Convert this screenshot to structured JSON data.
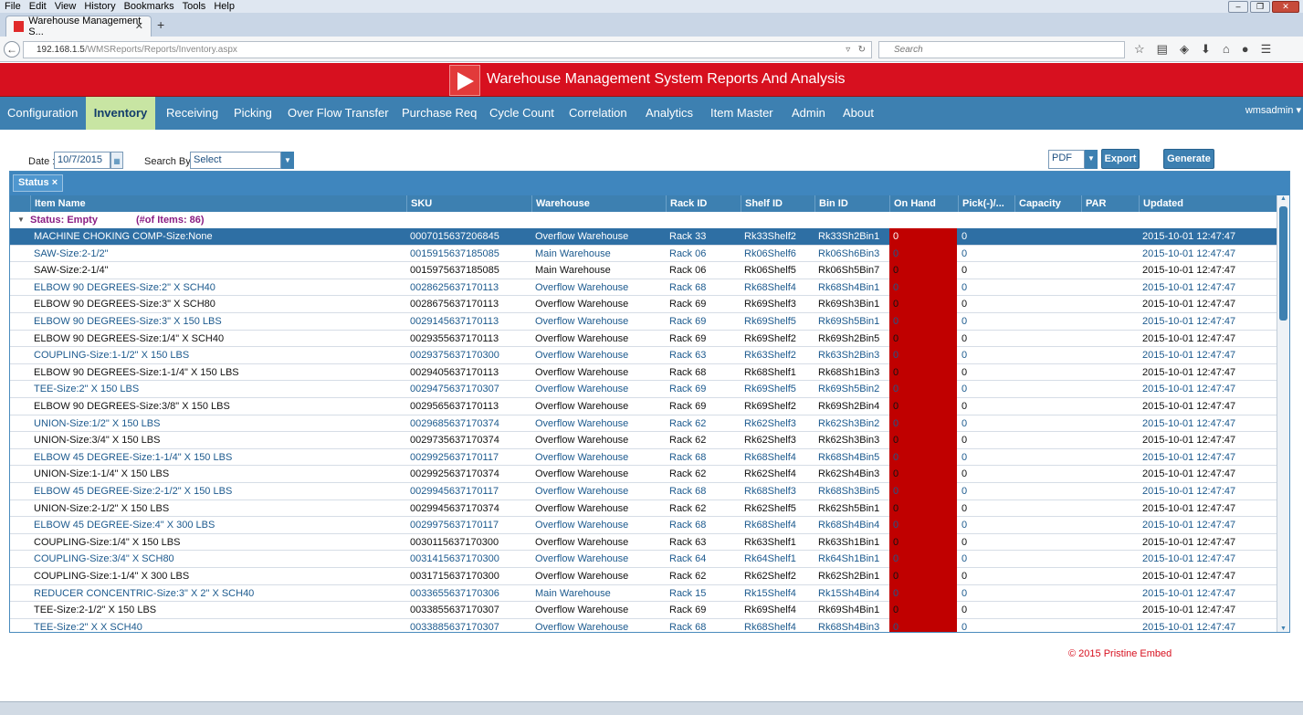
{
  "browser": {
    "menu": [
      "File",
      "Edit",
      "View",
      "History",
      "Bookmarks",
      "Tools",
      "Help"
    ],
    "tab_title": "Warehouse Management S...",
    "url_host": "192.168.1.5",
    "url_path": "/WMSReports/Reports/Inventory.aspx",
    "search_placeholder": "Search"
  },
  "app": {
    "title": "Warehouse Management System Reports And Analysis",
    "accent": "#d7101f",
    "nav_color": "#3d80b1"
  },
  "nav": {
    "items": [
      "Configuration",
      "Inventory",
      "Receiving",
      "Picking",
      "Over Flow Transfer",
      "Purchase Req",
      "Cycle Count",
      "Correlation",
      "Analytics",
      "Item Master",
      "Admin",
      "About"
    ],
    "active": "Inventory",
    "user": "wmsadmin"
  },
  "filters": {
    "date_label": "Date :",
    "date_value": "10/7/2015",
    "search_by_label": "Search By:",
    "search_by_value": "Select",
    "format_value": "PDF",
    "export_label": "Export",
    "generate_label": "Generate"
  },
  "grid": {
    "group_chip": "Status",
    "chip_close": "×",
    "columns": [
      "Item Name",
      "SKU",
      "Warehouse",
      "Rack ID",
      "Shelf ID",
      "Bin ID",
      "On Hand",
      "Pick(-)/...",
      "Capacity",
      "PAR",
      "Updated"
    ],
    "group_label": "Status: Empty",
    "group_count": "(#of Items: 86)",
    "rows": [
      [
        "MACHINE CHOKING COMP-Size:None",
        "0007015637206845",
        "Overflow Warehouse",
        "Rack 33",
        "Rk33Shelf2",
        "Rk33Sh2Bin1",
        "0",
        "0",
        "",
        "",
        "2015-10-01 12:47:47"
      ],
      [
        "SAW-Size:2-1/2\"",
        "0015915637185085",
        "Main Warehouse",
        "Rack 06",
        "Rk06Shelf6",
        "Rk06Sh6Bin3",
        "0",
        "0",
        "",
        "",
        "2015-10-01 12:47:47"
      ],
      [
        "SAW-Size:2-1/4\"",
        "0015975637185085",
        "Main Warehouse",
        "Rack 06",
        "Rk06Shelf5",
        "Rk06Sh5Bin7",
        "0",
        "0",
        "",
        "",
        "2015-10-01 12:47:47"
      ],
      [
        "ELBOW 90 DEGREES-Size:2\" X SCH40",
        "0028625637170113",
        "Overflow Warehouse",
        "Rack 68",
        "Rk68Shelf4",
        "Rk68Sh4Bin1",
        "0",
        "0",
        "",
        "",
        "2015-10-01 12:47:47"
      ],
      [
        "ELBOW 90 DEGREES-Size:3\" X SCH80",
        "0028675637170113",
        "Overflow Warehouse",
        "Rack 69",
        "Rk69Shelf3",
        "Rk69Sh3Bin1",
        "0",
        "0",
        "",
        "",
        "2015-10-01 12:47:47"
      ],
      [
        "ELBOW 90 DEGREES-Size:3\" X 150 LBS",
        "0029145637170113",
        "Overflow Warehouse",
        "Rack 69",
        "Rk69Shelf5",
        "Rk69Sh5Bin1",
        "0",
        "0",
        "",
        "",
        "2015-10-01 12:47:47"
      ],
      [
        "ELBOW 90 DEGREES-Size:1/4\" X SCH40",
        "0029355637170113",
        "Overflow Warehouse",
        "Rack 69",
        "Rk69Shelf2",
        "Rk69Sh2Bin5",
        "0",
        "0",
        "",
        "",
        "2015-10-01 12:47:47"
      ],
      [
        "COUPLING-Size:1-1/2\" X 150 LBS",
        "0029375637170300",
        "Overflow Warehouse",
        "Rack 63",
        "Rk63Shelf2",
        "Rk63Sh2Bin3",
        "0",
        "0",
        "",
        "",
        "2015-10-01 12:47:47"
      ],
      [
        "ELBOW 90 DEGREES-Size:1-1/4\" X 150 LBS",
        "0029405637170113",
        "Overflow Warehouse",
        "Rack 68",
        "Rk68Shelf1",
        "Rk68Sh1Bin3",
        "0",
        "0",
        "",
        "",
        "2015-10-01 12:47:47"
      ],
      [
        "TEE-Size:2\" X 150 LBS",
        "0029475637170307",
        "Overflow Warehouse",
        "Rack 69",
        "Rk69Shelf5",
        "Rk69Sh5Bin2",
        "0",
        "0",
        "",
        "",
        "2015-10-01 12:47:47"
      ],
      [
        "ELBOW 90 DEGREES-Size:3/8\" X 150 LBS",
        "0029565637170113",
        "Overflow Warehouse",
        "Rack 69",
        "Rk69Shelf2",
        "Rk69Sh2Bin4",
        "0",
        "0",
        "",
        "",
        "2015-10-01 12:47:47"
      ],
      [
        "UNION-Size:1/2\" X 150 LBS",
        "0029685637170374",
        "Overflow Warehouse",
        "Rack 62",
        "Rk62Shelf3",
        "Rk62Sh3Bin2",
        "0",
        "0",
        "",
        "",
        "2015-10-01 12:47:47"
      ],
      [
        "UNION-Size:3/4\" X 150 LBS",
        "0029735637170374",
        "Overflow Warehouse",
        "Rack 62",
        "Rk62Shelf3",
        "Rk62Sh3Bin3",
        "0",
        "0",
        "",
        "",
        "2015-10-01 12:47:47"
      ],
      [
        "ELBOW 45 DEGREE-Size:1-1/4\" X 150 LBS",
        "0029925637170117",
        "Overflow Warehouse",
        "Rack 68",
        "Rk68Shelf4",
        "Rk68Sh4Bin5",
        "0",
        "0",
        "",
        "",
        "2015-10-01 12:47:47"
      ],
      [
        "UNION-Size:1-1/4\" X 150 LBS",
        "0029925637170374",
        "Overflow Warehouse",
        "Rack 62",
        "Rk62Shelf4",
        "Rk62Sh4Bin3",
        "0",
        "0",
        "",
        "",
        "2015-10-01 12:47:47"
      ],
      [
        "ELBOW 45 DEGREE-Size:2-1/2\" X 150 LBS",
        "0029945637170117",
        "Overflow Warehouse",
        "Rack 68",
        "Rk68Shelf3",
        "Rk68Sh3Bin5",
        "0",
        "0",
        "",
        "",
        "2015-10-01 12:47:47"
      ],
      [
        "UNION-Size:2-1/2\" X 150 LBS",
        "0029945637170374",
        "Overflow Warehouse",
        "Rack 62",
        "Rk62Shelf5",
        "Rk62Sh5Bin1",
        "0",
        "0",
        "",
        "",
        "2015-10-01 12:47:47"
      ],
      [
        "ELBOW 45 DEGREE-Size:4\" X 300 LBS",
        "0029975637170117",
        "Overflow Warehouse",
        "Rack 68",
        "Rk68Shelf4",
        "Rk68Sh4Bin4",
        "0",
        "0",
        "",
        "",
        "2015-10-01 12:47:47"
      ],
      [
        "COUPLING-Size:1/4\" X 150 LBS",
        "0030115637170300",
        "Overflow Warehouse",
        "Rack 63",
        "Rk63Shelf1",
        "Rk63Sh1Bin1",
        "0",
        "0",
        "",
        "",
        "2015-10-01 12:47:47"
      ],
      [
        "COUPLING-Size:3/4\" X SCH80",
        "0031415637170300",
        "Overflow Warehouse",
        "Rack 64",
        "Rk64Shelf1",
        "Rk64Sh1Bin1",
        "0",
        "0",
        "",
        "",
        "2015-10-01 12:47:47"
      ],
      [
        "COUPLING-Size:1-1/4\" X 300 LBS",
        "0031715637170300",
        "Overflow Warehouse",
        "Rack 62",
        "Rk62Shelf2",
        "Rk62Sh2Bin1",
        "0",
        "0",
        "",
        "",
        "2015-10-01 12:47:47"
      ],
      [
        "REDUCER CONCENTRIC-Size:3\" X 2\" X SCH40",
        "0033655637170306",
        "Main Warehouse",
        "Rack 15",
        "Rk15Shelf4",
        "Rk15Sh4Bin4",
        "0",
        "0",
        "",
        "",
        "2015-10-01 12:47:47"
      ],
      [
        "TEE-Size:2-1/2\" X 150 LBS",
        "0033855637170307",
        "Overflow Warehouse",
        "Rack 69",
        "Rk69Shelf4",
        "Rk69Sh4Bin1",
        "0",
        "0",
        "",
        "",
        "2015-10-01 12:47:47"
      ],
      [
        "TEE-Size:2\" X X SCH40",
        "0033885637170307",
        "Overflow Warehouse",
        "Rack 68",
        "Rk68Shelf4",
        "Rk68Sh4Bin3",
        "0",
        "0",
        "",
        "",
        "2015-10-01 12:47:47"
      ]
    ],
    "on_hand_alert_color": "#c00000"
  },
  "footer": {
    "copyright": "© 2015 Pristine Embed"
  }
}
